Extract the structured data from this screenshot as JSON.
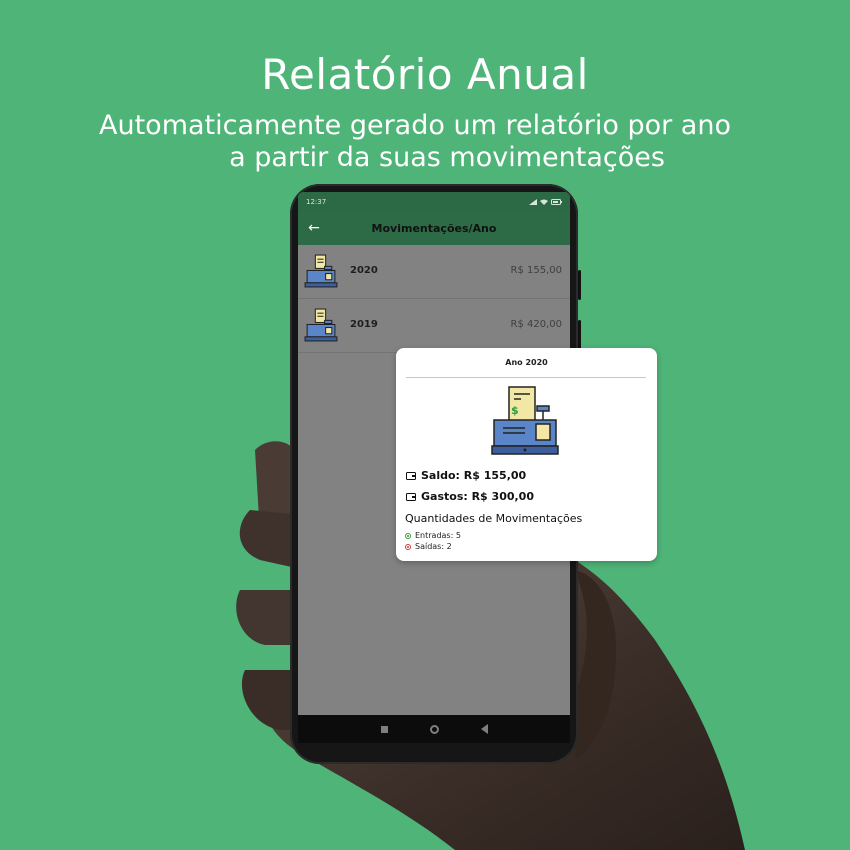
{
  "hero": {
    "title": "Relatório Anual",
    "subtitle_line1": "Automaticamente gerado um relatório por ano",
    "subtitle_line2": "a partir da suas movimentações"
  },
  "status_bar": {
    "time": "12:37"
  },
  "app_bar": {
    "title": "Movimentações/Ano",
    "back_icon": "arrow-left-icon"
  },
  "rows": [
    {
      "year": "2020",
      "amount": "R$ 155,00",
      "icon": "cash-register-icon"
    },
    {
      "year": "2019",
      "amount": "R$ 420,00",
      "icon": "cash-register-icon"
    }
  ],
  "popup": {
    "title": "Ano 2020",
    "saldo": "Saldo: R$ 155,00",
    "gastos": "Gastos: R$ 300,00",
    "quantities_title": "Quantidades de Movimentações",
    "entradas": "Entradas: 5",
    "saidas": "Saídas:  2"
  },
  "colors": {
    "background": "#4eb478",
    "app_bar": "#2d6b47",
    "entradas_icon": "#2e9a3c",
    "saidas_icon": "#d33a3a"
  }
}
